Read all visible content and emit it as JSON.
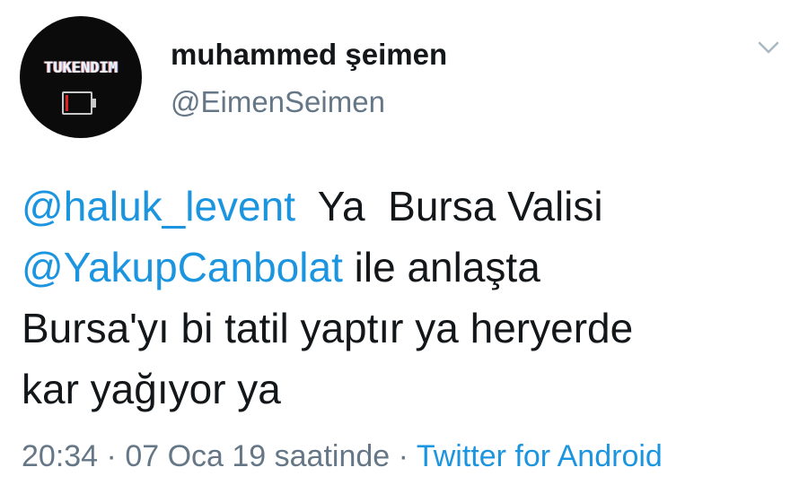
{
  "user": {
    "avatar_text": "TUKENDIM",
    "display_name": "muhammed şeimen",
    "handle": "@EimenSeimen"
  },
  "tweet": {
    "line1": {
      "mention": "@haluk_levent",
      "text": "  Ya  Bursa Valisi"
    },
    "line2": {
      "mention": "@YakupCanbolat",
      "text": " ile anlaşta"
    },
    "line3": "Bursa'yı bi tatil yaptır ya heryerde",
    "line4": "kar yağıyor ya"
  },
  "meta": {
    "time": "20:34",
    "separator1": " · ",
    "date": "07 Oca 19 saatinde",
    "separator2": " · ",
    "source": "Twitter for Android"
  },
  "icons": {
    "menu": "chevron-down-icon",
    "avatar_battery": "battery-low-icon"
  },
  "colors": {
    "link": "#1b95e0",
    "secondary": "#657786",
    "text": "#14171a",
    "battery_low": "#e02020"
  }
}
